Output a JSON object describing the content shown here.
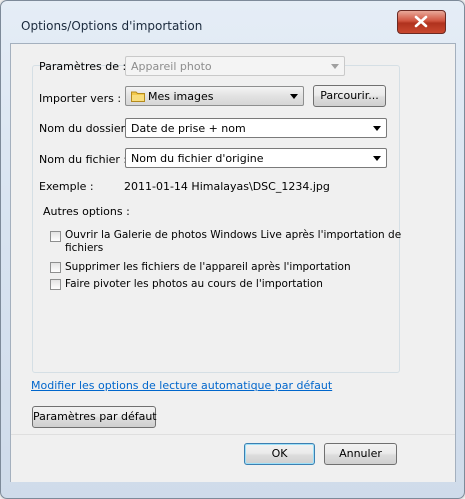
{
  "window": {
    "title": "Options/Options d'importation"
  },
  "settings_for": {
    "label": "Paramètres de :",
    "value": "Appareil photo"
  },
  "import_to": {
    "label": "Importer vers :",
    "value": "Mes images",
    "browse_label": "Parcourir..."
  },
  "folder_name": {
    "label": "Nom du dossier :",
    "value": "Date de prise + nom"
  },
  "file_name": {
    "label": "Nom du fichier :",
    "value": "Nom du fichier d'origine"
  },
  "example": {
    "label": "Exemple :",
    "value": "2011-01-14 Himalayas\\DSC_1234.jpg"
  },
  "other_options": {
    "label": "Autres options :",
    "items": [
      {
        "label_line1": "Ouvrir la Galerie de photos Windows Live après l'importation de",
        "label_line2": "fichiers",
        "checked": false
      },
      {
        "label": "Supprimer les fichiers de l'appareil après l'importation",
        "checked": false
      },
      {
        "label": "Faire pivoter les photos au cours de l'importation",
        "checked": false
      }
    ]
  },
  "autoplay_link": "Modifier les options de lecture automatique par défaut",
  "defaults_button": "Paramètres par défaut",
  "ok_button": "OK",
  "cancel_button": "Annuler",
  "icons": {
    "close": "close-icon",
    "folder": "folder-icon",
    "dropdown": "chevron-down-icon"
  }
}
